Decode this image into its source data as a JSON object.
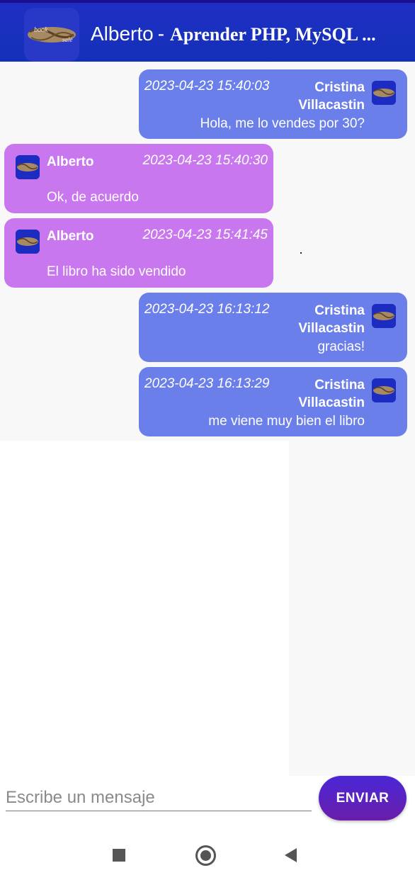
{
  "header": {
    "user_name": "Alberto",
    "separator": "-",
    "book_title": "Aprender PHP, MySQL ..."
  },
  "messages": [
    {
      "side": "sent",
      "timestamp": "2023-04-23 15:40:03",
      "author_first": "Cristina",
      "author_last": "Villacastin",
      "text": "Hola, me lo vendes por 30?"
    },
    {
      "side": "recv",
      "timestamp": "2023-04-23 15:40:30",
      "author_first": "Alberto",
      "author_last": "",
      "text": "Ok, de acuerdo"
    },
    {
      "side": "recv",
      "timestamp": "2023-04-23 15:41:45",
      "author_first": "Alberto",
      "author_last": "",
      "text": "El libro ha sido vendido"
    },
    {
      "side": "sent",
      "timestamp": "2023-04-23 16:13:12",
      "author_first": "Cristina",
      "author_last": "Villacastin",
      "text": "gracias!"
    },
    {
      "side": "sent",
      "timestamp": "2023-04-23 16:13:29",
      "author_first": "Cristina",
      "author_last": "Villacastin",
      "text": "me viene muy bien el libro"
    }
  ],
  "composer": {
    "placeholder": "Escribe un mensaje",
    "value": "",
    "send_label": "ENVIAR"
  },
  "colors": {
    "app_bar": "#1430b8",
    "sent_bubble": "#6b7fea",
    "received_bubble": "#c977ee",
    "send_button": "#5a22c0"
  },
  "icons": {
    "logo": "book-sale-logo-icon",
    "avatar": "book-sale-avatar-icon",
    "nav_recent": "square-icon",
    "nav_home": "circle-icon",
    "nav_back": "triangle-back-icon"
  }
}
